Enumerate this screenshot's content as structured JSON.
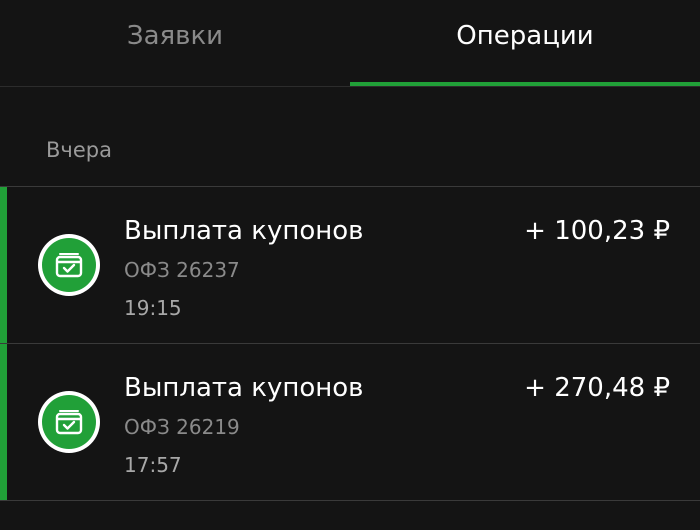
{
  "tabs": [
    {
      "label": "Заявки",
      "active": false
    },
    {
      "label": "Операции",
      "active": true
    }
  ],
  "colors": {
    "background": "#141414",
    "accent": "#21a038",
    "text_primary": "#ffffff",
    "text_secondary": "#8a8a8a"
  },
  "section": {
    "title": "Вчера"
  },
  "operations": [
    {
      "title": "Выплата купонов",
      "subtitle": "ОФЗ 26237",
      "time": "19:15",
      "amount": "+ 100,23 ₽",
      "icon": "wallet-check-icon"
    },
    {
      "title": "Выплата купонов",
      "subtitle": "ОФЗ 26219",
      "time": "17:57",
      "amount": "+ 270,48 ₽",
      "icon": "wallet-check-icon"
    }
  ]
}
